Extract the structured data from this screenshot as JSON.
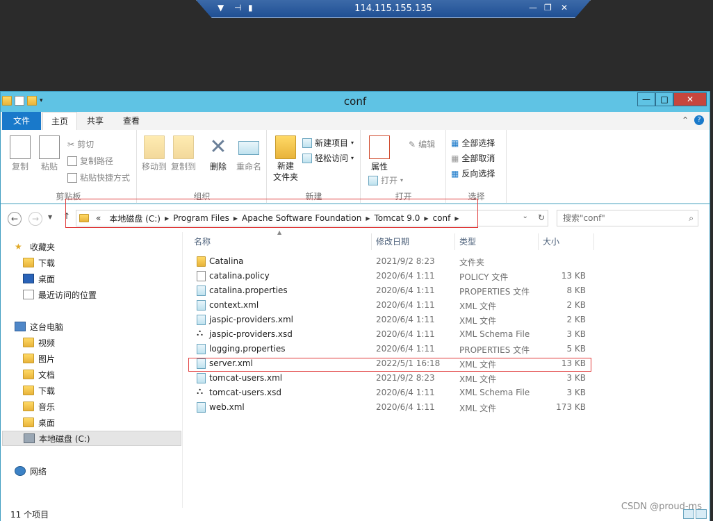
{
  "rdp": {
    "ip": "114.115.155.135"
  },
  "window": {
    "title": "conf"
  },
  "tabs": {
    "file": "文件",
    "home": "主页",
    "share": "共享",
    "view": "查看"
  },
  "ribbon": {
    "clipboard": {
      "copy": "复制",
      "paste": "粘贴",
      "cut": "剪切",
      "copy_path": "复制路径",
      "paste_shortcut": "粘贴快捷方式",
      "label": "剪贴板"
    },
    "organize": {
      "move_to": "移动到",
      "copy_to": "复制到",
      "delete": "删除",
      "rename": "重命名",
      "label": "组织"
    },
    "new": {
      "new_folder": "新建\n文件夹",
      "new_item": "新建项目",
      "easy_access": "轻松访问",
      "label": "新建"
    },
    "open": {
      "properties": "属性",
      "open": "打开",
      "edit": "编辑",
      "label": "打开"
    },
    "select": {
      "select_all": "全部选择",
      "select_none": "全部取消",
      "invert": "反向选择",
      "label": "选择"
    }
  },
  "address": {
    "prefix": "«",
    "crumbs": [
      "本地磁盘 (C:)",
      "Program Files",
      "Apache Software Foundation",
      "Tomcat 9.0",
      "conf"
    ]
  },
  "search": {
    "placeholder": "搜索\"conf\""
  },
  "sidebar": {
    "items": [
      {
        "label": "收藏夹",
        "icon": "star-icon"
      },
      {
        "label": "下载",
        "icon": "download-folder-icon"
      },
      {
        "label": "桌面",
        "icon": "desktop-icon"
      },
      {
        "label": "最近访问的位置",
        "icon": "recent-icon"
      },
      {
        "label": "这台电脑",
        "icon": "computer-icon"
      },
      {
        "label": "视频",
        "icon": "video-folder-icon"
      },
      {
        "label": "图片",
        "icon": "pictures-folder-icon"
      },
      {
        "label": "文档",
        "icon": "documents-folder-icon"
      },
      {
        "label": "下载",
        "icon": "download-folder-icon"
      },
      {
        "label": "音乐",
        "icon": "music-folder-icon"
      },
      {
        "label": "桌面",
        "icon": "desktop-folder-icon"
      },
      {
        "label": "本地磁盘 (C:)",
        "icon": "drive-icon"
      },
      {
        "label": "网络",
        "icon": "network-icon"
      }
    ]
  },
  "columns": {
    "name": "名称",
    "date": "修改日期",
    "type": "类型",
    "size": "大小"
  },
  "files": [
    {
      "name": "Catalina",
      "date": "2021/9/2 8:23",
      "type": "文件夹",
      "size": "",
      "icon": "folder"
    },
    {
      "name": "catalina.policy",
      "date": "2020/6/4 1:11",
      "type": "POLICY 文件",
      "size": "13 KB",
      "icon": "file"
    },
    {
      "name": "catalina.properties",
      "date": "2020/6/4 1:11",
      "type": "PROPERTIES 文件",
      "size": "8 KB",
      "icon": "xml"
    },
    {
      "name": "context.xml",
      "date": "2020/6/4 1:11",
      "type": "XML 文件",
      "size": "2 KB",
      "icon": "xml"
    },
    {
      "name": "jaspic-providers.xml",
      "date": "2020/6/4 1:11",
      "type": "XML 文件",
      "size": "2 KB",
      "icon": "xml"
    },
    {
      "name": "jaspic-providers.xsd",
      "date": "2020/6/4 1:11",
      "type": "XML Schema File",
      "size": "3 KB",
      "icon": "xsd"
    },
    {
      "name": "logging.properties",
      "date": "2020/6/4 1:11",
      "type": "PROPERTIES 文件",
      "size": "5 KB",
      "icon": "xml"
    },
    {
      "name": "server.xml",
      "date": "2022/5/1 16:18",
      "type": "XML 文件",
      "size": "13 KB",
      "icon": "xml"
    },
    {
      "name": "tomcat-users.xml",
      "date": "2021/9/2 8:23",
      "type": "XML 文件",
      "size": "3 KB",
      "icon": "xml"
    },
    {
      "name": "tomcat-users.xsd",
      "date": "2020/6/4 1:11",
      "type": "XML Schema File",
      "size": "3 KB",
      "icon": "xsd"
    },
    {
      "name": "web.xml",
      "date": "2020/6/4 1:11",
      "type": "XML 文件",
      "size": "173 KB",
      "icon": "xml"
    }
  ],
  "status": {
    "count": "11 个项目"
  },
  "watermark": "CSDN @proud-ms"
}
